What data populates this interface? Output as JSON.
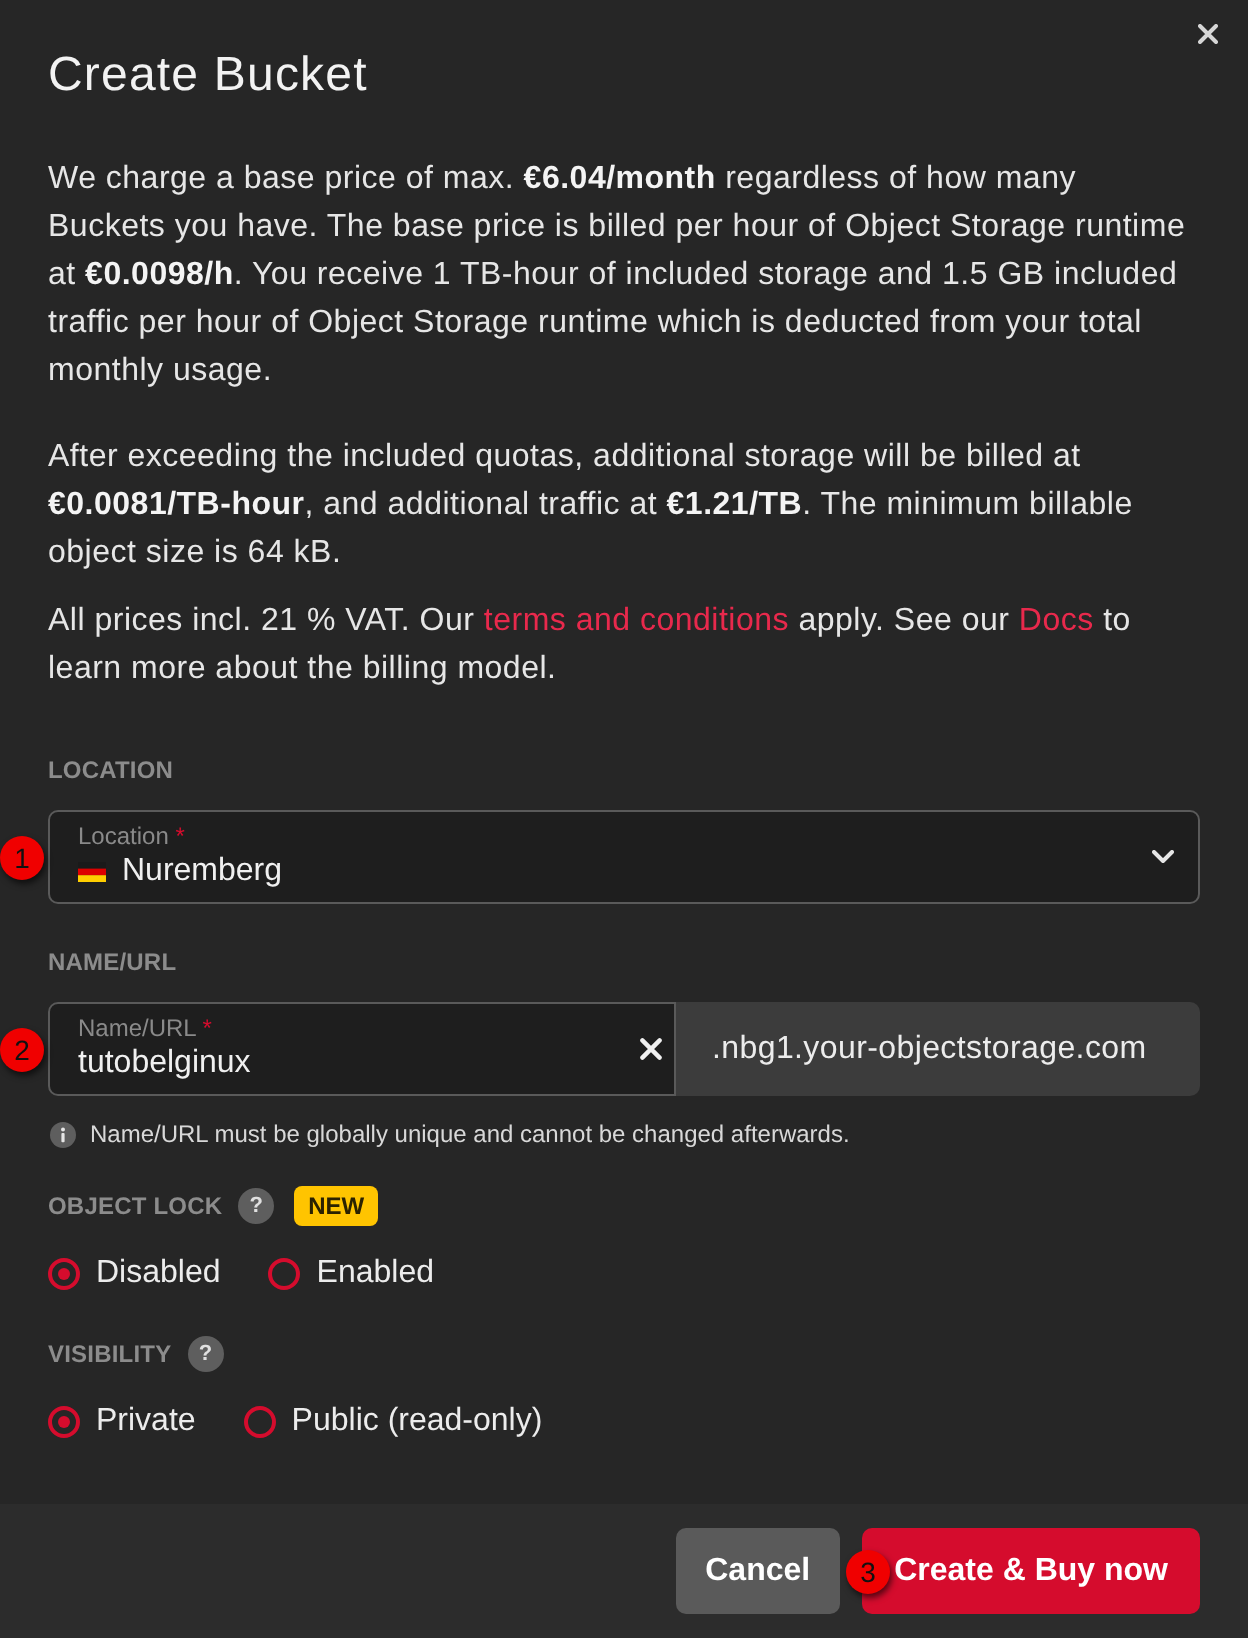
{
  "dialog": {
    "title": "Create Bucket"
  },
  "description": [
    {
      "parts": [
        {
          "kind": "text",
          "text": "We charge a base price of max. **€6.04/month** regardless of how many Buckets you have. The base price is billed per hour of Object Storage runtime at **€0.0098/h**. You receive 1 TB-hour of included storage and 1.5 GB included traffic per hour of Object Storage runtime which is deducted from your total monthly usage."
        }
      ]
    },
    {
      "parts": [
        {
          "kind": "text",
          "text": "After exceeding the included quotas, additional storage will be billed at **€0.0081/TB-hour**, and additional traffic at **€1.21/TB**. The minimum billable object size is 64 kB."
        }
      ]
    },
    {
      "parts": [
        {
          "kind": "text",
          "text": "All prices incl. 21 % VAT. Our "
        },
        {
          "kind": "link",
          "text": "terms and conditions"
        },
        {
          "kind": "text",
          "text": " apply. See our "
        },
        {
          "kind": "link",
          "text": "Docs"
        },
        {
          "kind": "text",
          "text": " to learn more about the billing model."
        }
      ]
    }
  ],
  "location": {
    "section_label": "LOCATION",
    "marker": "1",
    "field_label": "Location",
    "required_mark": "*",
    "value": "Nuremberg"
  },
  "name_url": {
    "section_label": "NAME/URL",
    "marker": "2",
    "field_label": "Name/URL",
    "required_mark": "*",
    "value": "tutobelginux",
    "suffix": ".nbg1.your-objectstorage.com",
    "hint": "Name/URL must be globally unique and cannot be changed afterwards."
  },
  "object_lock": {
    "section_label": "OBJECT LOCK",
    "help": "?",
    "badge": "NEW",
    "options": [
      {
        "label": "Disabled",
        "selected": true
      },
      {
        "label": "Enabled",
        "selected": false
      }
    ]
  },
  "visibility": {
    "section_label": "VISIBILITY",
    "help": "?",
    "options": [
      {
        "label": "Private",
        "selected": true
      },
      {
        "label": "Public (read-only)",
        "selected": false
      }
    ]
  },
  "buttons": [
    {
      "label": "Cancel",
      "kind": "secondary"
    },
    {
      "label": "Create & Buy now",
      "kind": "primary",
      "marker": "3"
    }
  ]
}
